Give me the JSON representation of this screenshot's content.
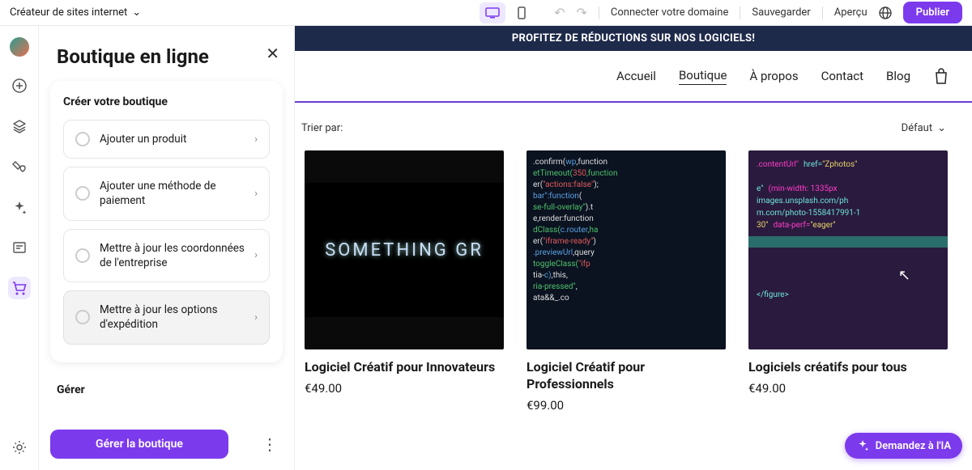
{
  "topbar": {
    "breadcrumb": "Créateur de sites internet",
    "connect_domain": "Connecter votre domaine",
    "save": "Sauvegarder",
    "preview": "Aperçu",
    "publish": "Publier"
  },
  "panel": {
    "title": "Boutique en ligne",
    "card_heading": "Créer votre boutique",
    "steps": [
      "Ajouter un produit",
      "Ajouter une méthode de paiement",
      "Mettre à jour les coordonnées de l'entreprise",
      "Mettre à jour les options d'expédition"
    ],
    "section_manage": "Gérer",
    "manage_btn": "Gérer la boutique"
  },
  "site": {
    "promo": "PROFITEZ DE RÉDUCTIONS SUR NOS LOGICIELS!",
    "nav": [
      "Accueil",
      "Boutique",
      "À propos",
      "Contact",
      "Blog"
    ],
    "active_nav_index": 1,
    "sort_label": "Trier par:",
    "sort_value": "Défaut",
    "products": [
      {
        "name": "Logiciel Créatif pour Innovateurs",
        "price": "€49.00",
        "img_label": "SOMETHING GR"
      },
      {
        "name": "Logiciel Créatif pour Professionnels",
        "price": "€99.00"
      },
      {
        "name": "Logiciels créatifs pour tous",
        "price": "€49.00"
      }
    ]
  },
  "ai_pill": "Demandez à l'IA"
}
